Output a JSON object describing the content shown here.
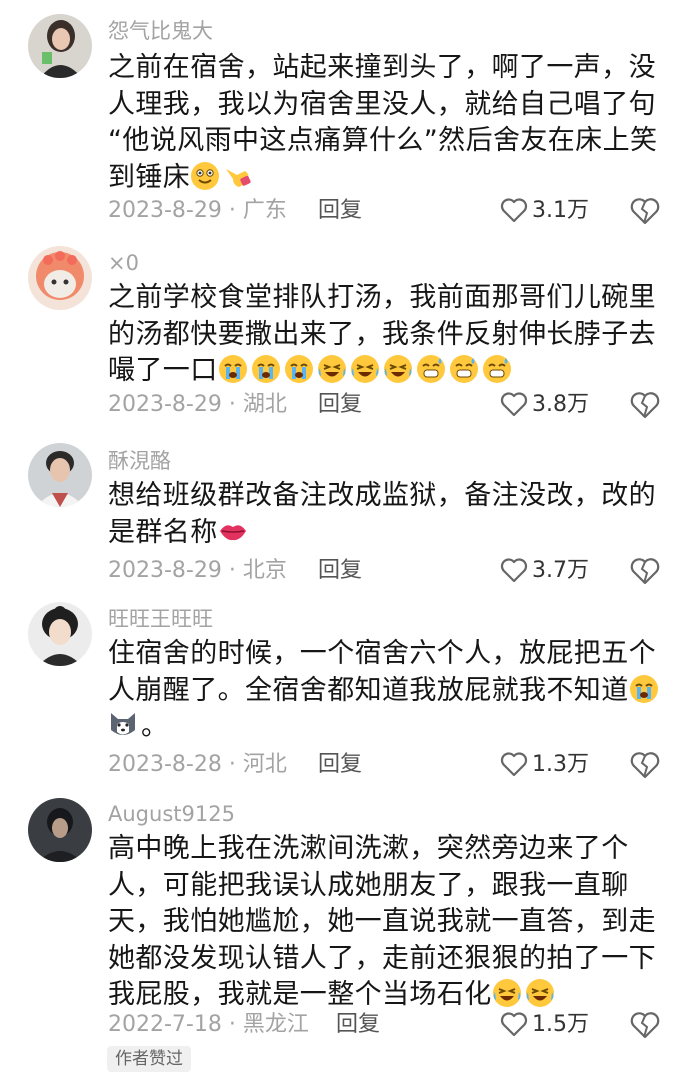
{
  "comments": [
    {
      "username": "怨气比鬼大",
      "lines": [
        "之前在宿舍，站起来撞到头了，啊了一声，没",
        "人理我，我以为宿舍里没人，就给自己唱了句",
        "“他说风雨中这点痛算什么”然后舍友在床上笑",
        "到锤床"
      ],
      "date": "2023-8-29",
      "region": "广东",
      "reply_label": "回复",
      "likes": "3.1万",
      "emojis": [
        "grin-sweat-emoji",
        "pointing-hand-emoji"
      ]
    },
    {
      "username": "×0",
      "lines": [
        "之前学校食堂排队打汤，我前面那哥们儿碗里",
        "的汤都快要撒出来了，我条件反射伸长脖子去",
        "嘬了一口"
      ],
      "date": "2023-8-29",
      "region": "湖北",
      "reply_label": "回复",
      "likes": "3.8万",
      "emojis": [
        "crying-emoji",
        "crying-emoji",
        "crying-emoji",
        "laugh-tears-emoji",
        "laugh-tears-emoji",
        "laugh-tears-emoji",
        "grin-sweat-emoji",
        "grin-sweat-emoji",
        "grin-sweat-emoji"
      ]
    },
    {
      "username": "酥涀酪",
      "lines": [
        "想给班级群改备注改成监狱，备注没改，改的",
        "是群名称"
      ],
      "date": "2023-8-29",
      "region": "北京",
      "reply_label": "回复",
      "likes": "3.7万",
      "emojis": [
        "lips-emoji"
      ]
    },
    {
      "username": "旺旺王旺旺",
      "lines": [
        "住宿舍的时候，一个宿舍六个人，放屁把五个",
        "人崩醒了。全宿舍都知道我放屁就我不知道",
        "。"
      ],
      "date": "2023-8-28",
      "region": "河北",
      "reply_label": "回复",
      "likes": "1.3万",
      "emojis": [
        "crying-emoji",
        "husky-emoji"
      ]
    },
    {
      "username": "August9125",
      "lines": [
        "高中晚上我在洗漱间洗漱，突然旁边来了个",
        "人，可能把我误认成她朋友了，跟我一直聊",
        "天，我怕她尴尬，她一直说我就一直答，到走",
        "她都没发现认错人了，走前还狠狠的拍了一下",
        "我屁股，我就是一整个当场石化"
      ],
      "date": "2022-7-18",
      "region": "黑龙江",
      "reply_label": "回复",
      "likes": "1.5万",
      "badge": "作者赞过",
      "emojis": [
        "laugh-tears-emoji",
        "laugh-tears-emoji"
      ]
    }
  ],
  "colors": {
    "meta": "#a3a3a3",
    "text": "#161616",
    "emoji_yellow": "#ffc83d"
  }
}
